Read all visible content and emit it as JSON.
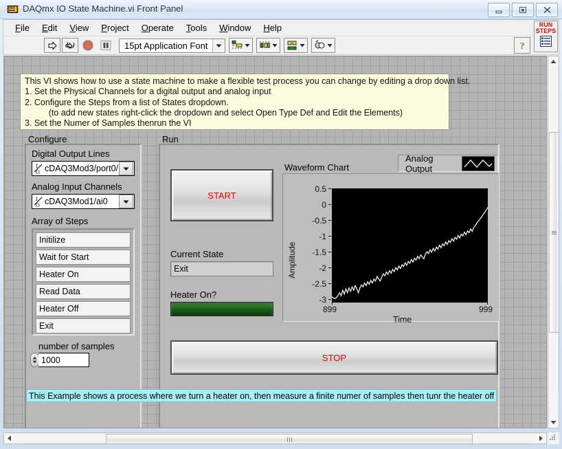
{
  "window": {
    "title": "DAQmx IO State Machine.vi Front Panel",
    "icon": "labview-vi-icon",
    "buttons": {
      "minimize": "minimize-icon",
      "maximize": "maximize-icon",
      "close": "close-icon"
    }
  },
  "menu": {
    "items": [
      {
        "label": "File",
        "mnemonic": "F"
      },
      {
        "label": "Edit",
        "mnemonic": "E"
      },
      {
        "label": "View",
        "mnemonic": "V"
      },
      {
        "label": "Project",
        "mnemonic": "P"
      },
      {
        "label": "Operate",
        "mnemonic": "O"
      },
      {
        "label": "Tools",
        "mnemonic": "T"
      },
      {
        "label": "Window",
        "mnemonic": "W"
      },
      {
        "label": "Help",
        "mnemonic": "H"
      }
    ]
  },
  "toolbar": {
    "run_icon": "run-arrow-icon",
    "run_continuous_icon": "run-continuously-icon",
    "abort_icon": "abort-execution-icon",
    "pause_icon": "pause-icon",
    "font_value": "15pt Application Font",
    "font_dropdown_icon": "chevron-down-icon",
    "align_icon": "align-objects-icon",
    "distribute_icon": "distribute-objects-icon",
    "resize_icon": "resize-objects-icon",
    "reorder_icon": "reorder-objects-icon",
    "help_icon": "context-help-icon",
    "run_steps": {
      "line1": "RUN",
      "line2": "STEPS",
      "icon": "list-steps-icon"
    }
  },
  "instructions": {
    "lines": [
      "This VI shows how to use a state machine to make a flexible test process you can change by editing a drop down list.",
      "1. Set the Physical Channels for a digital output and analog input",
      "2. Configure the Steps from a list of States dropdown.",
      "          (to add new states right-click the dropdown and select Open Type Def and Edit the Elements)",
      "3. Set the Numer of Samples thenrun the VI"
    ]
  },
  "configure": {
    "title": "Configure",
    "digital_output": {
      "label": "Digital Output Lines",
      "value": "cDAQ3Mod3/port0/",
      "icon": "io-channel-icon",
      "dropdown_icon": "chevron-down-icon"
    },
    "analog_input": {
      "label": "Analog Input Channels",
      "value": "cDAQ3Mod1/ai0",
      "icon": "io-channel-icon",
      "dropdown_icon": "chevron-down-icon"
    },
    "array_of_steps": {
      "label": "Array of Steps",
      "items": [
        "Initilize",
        "Wait for Start",
        "Heater On",
        "Read Data",
        "Heater Off",
        "Exit"
      ]
    },
    "number_of_samples": {
      "label": "number of samples",
      "value": "1000",
      "spinner_icon": "increment-decrement-icon"
    }
  },
  "run": {
    "title": "Run",
    "start_button": "START",
    "stop_button": "STOP",
    "current_state": {
      "label": "Current State",
      "value": "Exit"
    },
    "heater": {
      "label": "Heater On?",
      "state": "on",
      "color": "#2d7a2a"
    }
  },
  "chart_data": {
    "type": "line",
    "title": "Waveform Chart",
    "xlabel": "Time",
    "ylabel": "Amplitude",
    "legend": [
      {
        "name": "Analog Output",
        "color": "#ffffff"
      }
    ],
    "legend_position": "top-right",
    "grid": false,
    "background": "#000000",
    "xlim": [
      899,
      999
    ],
    "ylim": [
      -3,
      0.5
    ],
    "xticks": [
      "899",
      "999"
    ],
    "yticks": [
      "0.5",
      "0",
      "-0.5",
      "-1",
      "-1.5",
      "-2",
      "-2.5",
      "-3"
    ],
    "x": [
      899,
      900,
      901,
      902,
      903,
      904,
      905,
      906,
      907,
      908,
      909,
      910,
      911,
      912,
      913,
      914,
      915,
      916,
      917,
      918,
      919,
      920,
      921,
      922,
      923,
      924,
      925,
      926,
      927,
      928,
      929,
      930,
      931,
      932,
      933,
      934,
      935,
      936,
      937,
      938,
      939,
      940,
      941,
      942,
      943,
      944,
      945,
      946,
      947,
      948,
      949,
      950,
      951,
      952,
      953,
      954,
      955,
      956,
      957,
      958,
      959,
      960,
      961,
      962,
      963,
      964,
      965,
      966,
      967,
      968,
      969,
      970,
      971,
      972,
      973,
      974,
      975,
      976,
      977,
      978,
      979,
      980,
      981,
      982,
      983,
      984,
      985,
      986,
      987,
      988,
      989,
      990,
      991,
      992,
      993,
      994,
      995,
      996,
      997,
      998,
      999
    ],
    "series": [
      {
        "name": "Analog Output",
        "values": [
          -2.82,
          -2.86,
          -2.88,
          -2.84,
          -2.78,
          -2.7,
          -2.79,
          -2.62,
          -2.74,
          -2.58,
          -2.7,
          -2.55,
          -2.66,
          -2.52,
          -2.62,
          -2.48,
          -2.58,
          -2.7,
          -2.55,
          -2.46,
          -2.52,
          -2.4,
          -2.48,
          -2.36,
          -2.44,
          -2.32,
          -2.4,
          -2.28,
          -2.34,
          -2.2,
          -2.28,
          -2.34,
          -2.22,
          -2.12,
          -2.18,
          -2.06,
          -2.14,
          -2.02,
          -2.1,
          -1.98,
          -2.05,
          -1.93,
          -2.0,
          -1.88,
          -1.96,
          -1.84,
          -1.9,
          -1.78,
          -1.86,
          -1.74,
          -1.8,
          -1.68,
          -1.76,
          -1.64,
          -1.7,
          -1.58,
          -1.66,
          -1.54,
          -1.6,
          -1.66,
          -1.52,
          -1.44,
          -1.5,
          -1.38,
          -1.46,
          -1.34,
          -1.42,
          -1.3,
          -1.36,
          -1.24,
          -1.32,
          -1.2,
          -1.26,
          -1.14,
          -1.22,
          -1.1,
          -1.16,
          -1.04,
          -1.12,
          -1.0,
          -1.06,
          -0.94,
          -1.02,
          -0.9,
          -0.96,
          -0.84,
          -0.92,
          -0.8,
          -0.86,
          -0.74,
          -0.82,
          -0.7,
          -0.64,
          -0.56,
          -0.5,
          -0.44,
          -0.38,
          -0.3,
          -0.24,
          -0.16,
          -0.08
        ]
      }
    ]
  },
  "bottom_note": {
    "text": "This Example shows a process where we turn a heater on, then measure a finite numer of samples then tunr the heater off",
    "highlight_color": "#a8eef7"
  },
  "scrollbars": {
    "vertical_up_icon": "triangle-up-icon",
    "vertical_down_icon": "triangle-down-icon",
    "horizontal_left_icon": "triangle-left-icon",
    "horizontal_right_icon": "triangle-right-icon"
  }
}
